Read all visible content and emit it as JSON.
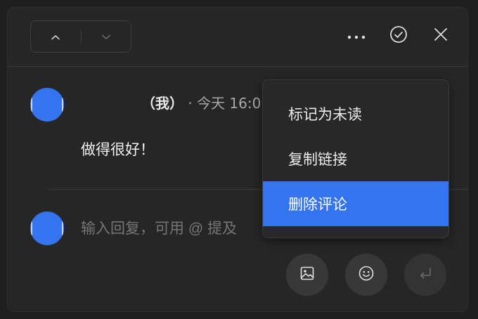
{
  "header": {
    "nav_up_icon": "chevron-up-icon",
    "nav_down_icon": "chevron-down-icon",
    "more_icon": "more-horizontal-icon",
    "resolve_icon": "check-circle-icon",
    "close_icon": "close-icon"
  },
  "comment": {
    "author_suffix": "（我）",
    "separator": "·",
    "time": "今天 16:0",
    "body": "做得很好！"
  },
  "reply": {
    "placeholder": "输入回复，可用 @ 提及"
  },
  "reply_actions": {
    "image_icon": "image-icon",
    "emoji_icon": "emoji-icon",
    "send_icon": "enter-icon"
  },
  "context_menu": {
    "items": [
      {
        "label": "标记为未读"
      },
      {
        "label": "复制链接"
      },
      {
        "label": "删除评论",
        "highlighted": true
      }
    ]
  },
  "colors": {
    "accent": "#3574f0",
    "background": "#262626",
    "text_primary": "#f0f0f0",
    "text_secondary": "#a8a8a8",
    "placeholder": "#5f5f5f"
  }
}
